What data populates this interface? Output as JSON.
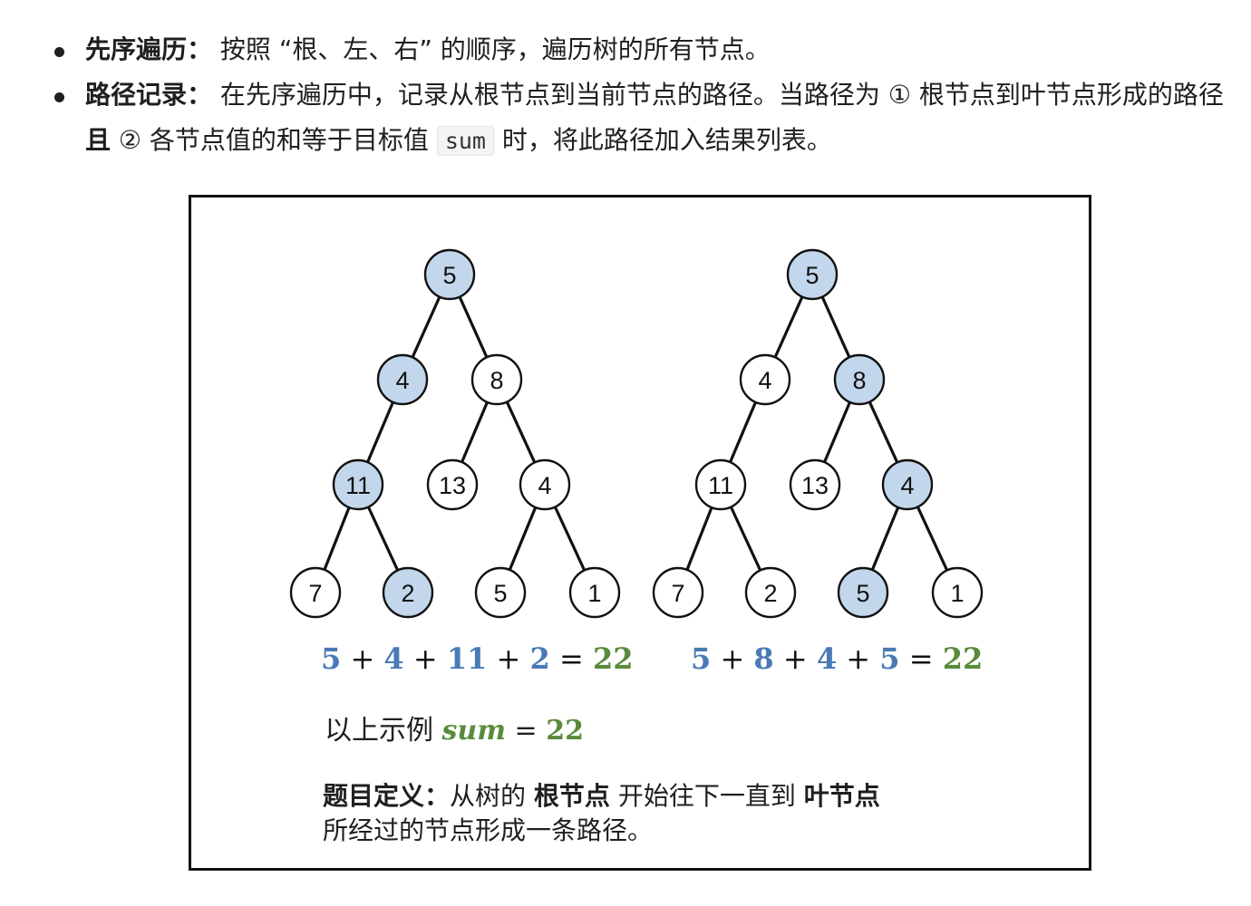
{
  "text": {
    "bullet1_title": "先序遍历：",
    "bullet1_body": "按照 “根、左、右” 的顺序，遍历树的所有节点。",
    "bullet2_title": "路径记录：",
    "bullet2_pre": "在先序遍历中，记录从根节点到当前节点的路径。当路径为 ① 根节点到叶节点形成的路径 ",
    "bullet2_and": "且",
    "bullet2_mid": " ② 各节点值的和等于目标值 ",
    "bullet2_code": "sum",
    "bullet2_post": " 时，将此路径加入结果列表。"
  },
  "trees": [
    {
      "values": [
        "5",
        "4",
        "8",
        "11",
        "13",
        "4",
        "7",
        "2",
        "5",
        "1"
      ],
      "highlighted": [
        0,
        1,
        3,
        7
      ],
      "equation": {
        "terms": [
          "5",
          "4",
          "11",
          "2"
        ],
        "op": "+",
        "eq": "=",
        "result": "22"
      }
    },
    {
      "values": [
        "5",
        "4",
        "8",
        "11",
        "13",
        "4",
        "7",
        "2",
        "5",
        "1"
      ],
      "highlighted": [
        0,
        2,
        5,
        8
      ],
      "equation": {
        "terms": [
          "5",
          "8",
          "4",
          "5"
        ],
        "op": "+",
        "eq": "=",
        "result": "22"
      }
    }
  ],
  "example": {
    "prefix": "以上示例 ",
    "var": "sum",
    "eq": "=",
    "value": "22"
  },
  "caption": {
    "label": "题目定义：",
    "part1": "从树的 ",
    "root": "根节点",
    "part2": " 开始往下一直到 ",
    "leaf": "叶节点",
    "part3": "所经过的节点形成一条路径。"
  },
  "colors": {
    "node_fill_highlight": "#c3d7ec",
    "node_fill": "#ffffff",
    "term_blue": "#4a7ab5",
    "result_green": "#5a8a3c",
    "edge": "#111111"
  }
}
